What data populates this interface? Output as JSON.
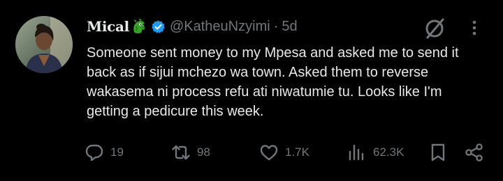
{
  "author": {
    "display_name": "Mical",
    "name_emoji": "dragon-face-emoji",
    "verified": true,
    "handle": "@KatheuNzyimi",
    "separator": "·",
    "timestamp": "5d"
  },
  "tweet": {
    "lines": [
      "Someone sent money to my Mpesa and asked me to send it",
      "back as if sijui mchezo wa town. Asked them to reverse",
      "wakasema ni process refu ati niwatumie tu. Looks like I'm",
      "getting a pedicure this week."
    ]
  },
  "actions": {
    "replies": "19",
    "reposts": "98",
    "likes": "1.7K",
    "views": "62.3K"
  },
  "icons": {
    "reply": "speech-bubble-icon",
    "repost": "repost-arrows-icon",
    "like": "heart-icon",
    "views": "bar-chart-icon",
    "bookmark": "bookmark-icon",
    "share": "share-icon",
    "grok": "grok-slash-icon",
    "more": "more-dots-icon"
  },
  "colors": {
    "background": "#000000",
    "primary_text": "#e7e9ea",
    "secondary_text": "#71767b",
    "verified_blue": "#1d9bf0"
  }
}
